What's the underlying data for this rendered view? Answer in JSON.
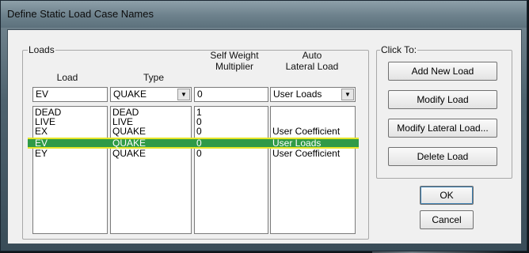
{
  "window": {
    "title": "Define Static Load Case Names"
  },
  "loads_group": {
    "legend": "Loads",
    "headers": {
      "load": "Load",
      "type": "Type",
      "self_weight": "Self Weight\nMultiplier",
      "auto_lateral": "Auto\nLateral Load"
    },
    "inputs": {
      "load": "EV",
      "type": "QUAKE",
      "self_weight": "0",
      "auto_lateral": "User Loads"
    },
    "rows": [
      {
        "load": "DEAD",
        "type": "DEAD",
        "multiplier": "1",
        "lateral": ""
      },
      {
        "load": "LIVE",
        "type": "LIVE",
        "multiplier": "0",
        "lateral": ""
      },
      {
        "load": "EX",
        "type": "QUAKE",
        "multiplier": "0",
        "lateral": "User Coefficient"
      },
      {
        "load": "EV",
        "type": "QUAKE",
        "multiplier": "0",
        "lateral": "User Loads"
      },
      {
        "load": "EY",
        "type": "QUAKE",
        "multiplier": "0",
        "lateral": "User Coefficient"
      }
    ],
    "selected_row": 3
  },
  "click_group": {
    "legend": "Click To:",
    "add": "Add New Load",
    "modify": "Modify Load",
    "modify_lateral": "Modify Lateral Load...",
    "delete": "Delete Load"
  },
  "ok": "OK",
  "cancel": "Cancel",
  "colors": {
    "selection": "#2f9a47",
    "selection_border": "#e6e629"
  }
}
